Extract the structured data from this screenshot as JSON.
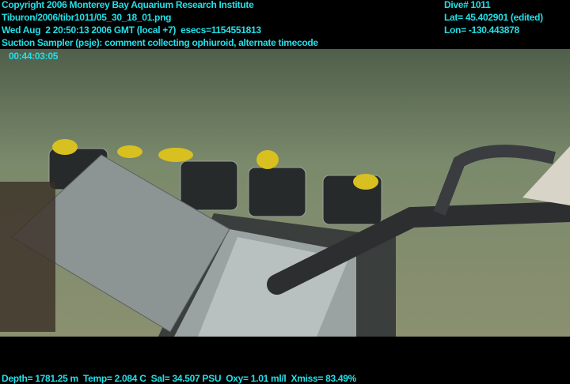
{
  "header": {
    "copyright": "Copyright 2006 Monterey Bay Aquarium Research Institute",
    "file_path": "Tiburon/2006/tibr1011/05_30_18_01.png",
    "datetime": "Wed Aug  2 20:50:13 2006 GMT (local +7)  esecs=1154551813",
    "comment": "Suction Sampler (psje): comment collecting ophiuroid, alternate timecode",
    "timecode": "00:44:03:05"
  },
  "position": {
    "dive": "Dive# 1011",
    "lat": "Lat= 45.402901 (edited)",
    "lon": "Lon= -130.443878"
  },
  "sensors": {
    "line": "Depth= 1781.25 m  Temp= 2.084 C  Sal= 34.507 PSU  Oxy= 1.01 ml/l  Xmiss= 83.49%"
  },
  "colors": {
    "overlay_text": "#22e0e8",
    "seafloor": "#7a8a6a"
  }
}
